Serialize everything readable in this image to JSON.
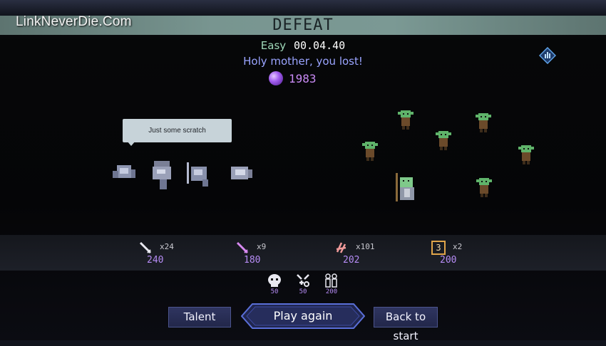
{
  "watermark": "LinkNeverDie.Com",
  "header": {
    "title": "DEFEAT",
    "difficulty": "Easy",
    "time": "00.04.40",
    "message": "Holy mother, you lost!",
    "currency_value": "1983"
  },
  "speech_bubble": "Just some scratch",
  "stats": [
    {
      "multiplier": "x24",
      "points": "240",
      "icon": "sword-icon"
    },
    {
      "multiplier": "x9",
      "points": "180",
      "icon": "magic-sword-icon"
    },
    {
      "multiplier": "x101",
      "points": "202",
      "icon": "claw-icon"
    },
    {
      "multiplier": "x2",
      "points": "200",
      "icon": "level-3-icon",
      "badge": "3"
    }
  ],
  "bonuses": [
    {
      "value": "50",
      "icon": "skull-icon"
    },
    {
      "value": "50",
      "icon": "heal-icon"
    },
    {
      "value": "200",
      "icon": "party-icon"
    }
  ],
  "buttons": {
    "talent": "Talent",
    "play_again": "Play again",
    "back_to_start": "Back to start"
  },
  "colors": {
    "banner": "#789590",
    "accent_purple": "#b68cf5",
    "message_blue": "#9aa4ff",
    "difficulty_green": "#9fd8b8"
  }
}
